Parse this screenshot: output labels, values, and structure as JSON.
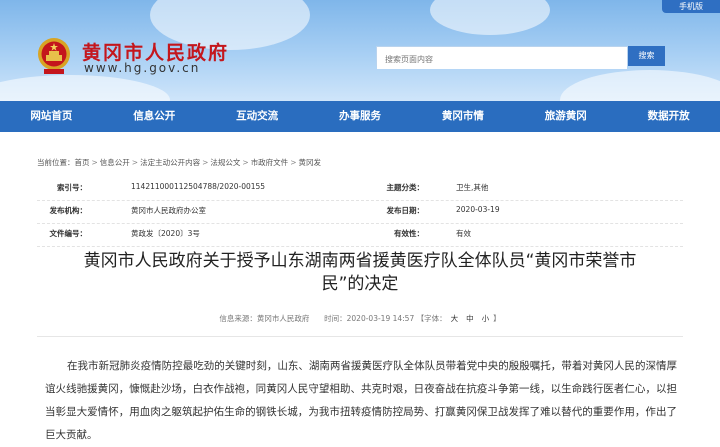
{
  "header": {
    "mobile_label": "手机版",
    "site_title": "黄冈市人民政府",
    "site_url": "www.hg.gov.cn",
    "search_placeholder": "搜索页面内容",
    "search_button": "搜索"
  },
  "nav": {
    "items": [
      "网站首页",
      "信息公开",
      "互动交流",
      "办事服务",
      "黄冈市情",
      "旅游黄冈",
      "数据开放"
    ]
  },
  "breadcrumb": {
    "prefix": "当前位置：",
    "items": [
      "首页",
      "信息公开",
      "法定主动公开内容",
      "法规公文",
      "市政府文件",
      "黄冈发"
    ]
  },
  "meta": {
    "index_label": "索引号：",
    "index_value": "114211000112504788/2020-00155",
    "topic_label": "主题分类：",
    "topic_value": "卫生,其他",
    "issuer_label": "发布机构：",
    "issuer_value": "黄冈市人民政府办公室",
    "date_label": "发布日期：",
    "date_value": "2020-03-19",
    "docno_label": "文件编号：",
    "docno_value": "黄政发〔2020〕3号",
    "validity_label": "有效性：",
    "validity_value": "有效"
  },
  "article": {
    "title_line1": "黄冈市人民政府关于授予山东湖南两省援黄医疗队全体队员“黄冈市荣誉市",
    "title_line2": "民”的决定",
    "source": "信息来源：黄冈市人民政府",
    "time": "时间：2020-03-19 14:57",
    "font_label": "【字体：",
    "font_large": "大",
    "font_medium": "中",
    "font_small": "小",
    "font_end": "】",
    "body": "在我市新冠肺炎疫情防控最吃劲的关键时刻，山东、湖南两省援黄医疗队全体队员带着党中央的殷殷嘱托，带着对黄冈人民的深情厚谊火线驰援黄冈，慷慨赴沙场，白衣作战袍，同黄冈人民守望相助、共克时艰，日夜奋战在抗疫斗争第一线，以生命践行医者仁心，以担当彰显大爱情怀，用血肉之躯筑起护佑生命的钢铁长城，为我市扭转疫情防控局势、打赢黄冈保卫战发挥了难以替代的重要作用，作出了巨大贡献。"
  },
  "colors": {
    "nav_bg": "#2a6dbf",
    "title_red": "#c4161c",
    "header_sky": "#a9d0f4"
  }
}
